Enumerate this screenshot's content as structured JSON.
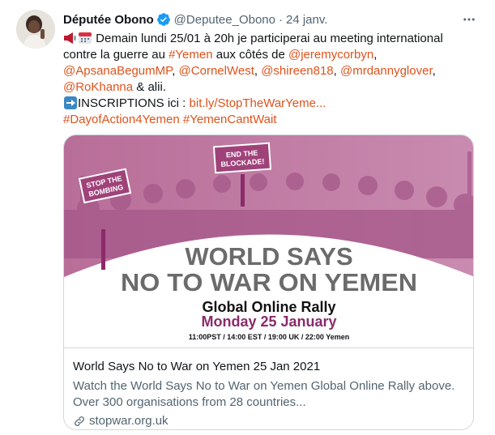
{
  "tweet": {
    "author_name": "Députée Obono",
    "handle": "@Deputee_Obono",
    "separator": "·",
    "date": "24 janv.",
    "more_icon": "more-horizontal-icon",
    "verified_icon": "verified-badge-icon",
    "lines": {
      "l1": {
        "text": " Demain lundi 25/01 à 20h je participerai au meeting international"
      },
      "l2": {
        "a": "contre la guerre au ",
        "b": "#Yemen",
        "c": " aux côtés de ",
        "d": "@jeremycorbyn",
        "e": ","
      },
      "l3": {
        "a": "@ApsanaBegumMP",
        "b": ", ",
        "c": "@CornelWest",
        "d": ", ",
        "e": "@shireen818",
        "f": ", ",
        "g": "@mrdannyglover",
        "h": ","
      },
      "l4": {
        "a": "@RoKhanna",
        "b": " & alii."
      },
      "l5": {
        "a": "INSCRIPTIONS ici : ",
        "b": "bit.ly/StopTheWarYeme..."
      },
      "l6": {
        "a": "#DayofAction4Yemen",
        "b": " ",
        "c": "#YemenCantWait"
      }
    },
    "emoji_icons": [
      "megaphone-icon",
      "calendar-icon",
      "right-arrow-icon"
    ]
  },
  "card": {
    "image": {
      "sign_left": [
        "STOP THE",
        "BOMBING"
      ],
      "sign_right": [
        "END THE",
        "BLOCKADE!"
      ],
      "headline_1": "WORLD SAYS",
      "headline_2": "NO TO WAR ON YEMEN",
      "subhead": "Global Online Rally",
      "date_line": "Monday 25 January",
      "times": "11:00PST / 14:00 EST / 19:00 UK / 22:00 Yemen"
    },
    "title": "World Says No to War on Yemen 25 Jan 2021",
    "description_1": "Watch the World Says No to War on Yemen Global Online Rally above.",
    "description_2": "Over 300 organisations from 28 countries...",
    "domain": "stopwar.org.uk",
    "domain_icon": "link-icon"
  },
  "colors": {
    "link": "#e0521b",
    "banner_purple": "#a0427a",
    "crowd_purple": "#b96b97",
    "headline_gray": "#6b6b6b",
    "date_purple": "#8a2b6a"
  }
}
